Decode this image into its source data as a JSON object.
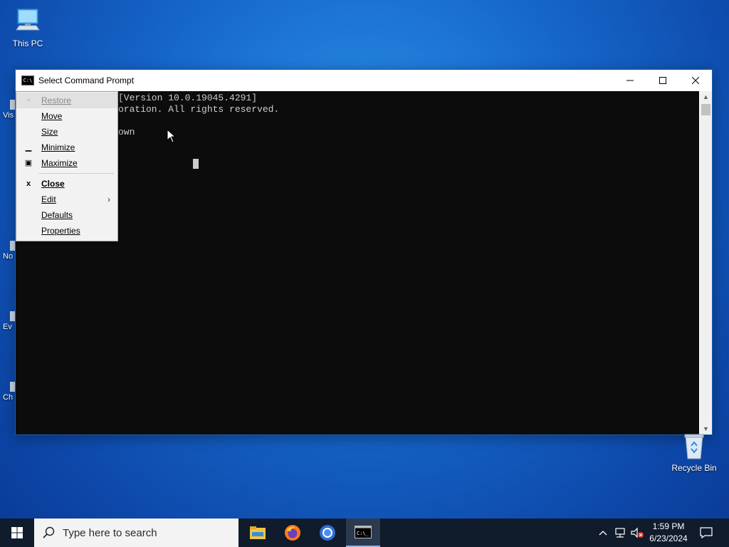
{
  "desktop": {
    "icons": [
      {
        "label": "This PC",
        "icon": "computer-icon"
      }
    ],
    "partial_icons": [
      "Vis",
      "No",
      "Ev",
      "Ch"
    ],
    "recycle_bin": {
      "label": "Recycle Bin",
      "icon": "recycle-bin-icon"
    }
  },
  "window": {
    "title": "Select Command Prompt",
    "app_icon": "cmd-icon",
    "controls": [
      "minimize-icon",
      "maximize-icon",
      "close-icon"
    ],
    "console_lines": [
      "[Version 10.0.19045.4291]",
      "oration. All rights reserved.",
      "own"
    ]
  },
  "system_menu": {
    "items": [
      {
        "label": "Restore",
        "icon": "restore-icon",
        "disabled": true
      },
      {
        "label": "Move"
      },
      {
        "label": "Size"
      },
      {
        "label": "Minimize",
        "icon": "minimize-icon"
      },
      {
        "label": "Maximize",
        "icon": "maximize-icon"
      },
      {
        "label": "Close",
        "icon": "close-icon",
        "bold": true
      },
      {
        "label": "Edit",
        "submenu": true
      },
      {
        "label": "Defaults"
      },
      {
        "label": "Properties"
      }
    ]
  },
  "taskbar": {
    "search_placeholder": "Type here to search",
    "apps": [
      "file-explorer-icon",
      "firefox-icon",
      "chrome-icon",
      "cmd-icon"
    ],
    "active_app": "cmd-icon",
    "tray_icons": [
      "chevron-up-icon",
      "network-icon",
      "volume-muted-icon",
      "notifications-icon"
    ],
    "clock": {
      "time": "1:59 PM",
      "date": "6/23/2024"
    }
  },
  "colors": {
    "console_bg": "#0c0c0c",
    "console_fg": "#cccccc",
    "taskbar_bg": "#101b2c",
    "desktop_accent": "#1565c8"
  }
}
